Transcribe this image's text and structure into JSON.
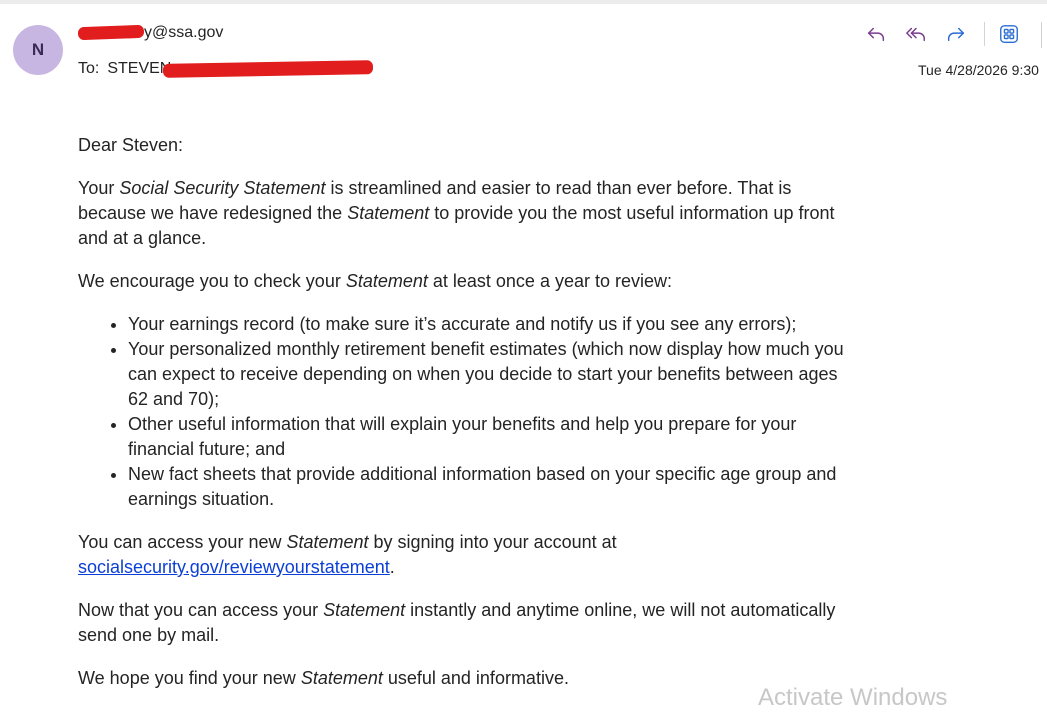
{
  "header": {
    "avatar_initial": "N",
    "sender_email": "y@ssa.gov",
    "to_label": "To:",
    "recipient": "STEVEN",
    "date": "Tue 4/28/2026 9:30"
  },
  "actions": [
    {
      "name": "reply",
      "icon": "reply-icon",
      "color": "#7a3d8f"
    },
    {
      "name": "reply-all",
      "icon": "reply-all-icon",
      "color": "#7a3d8f"
    },
    {
      "name": "forward",
      "icon": "forward-icon",
      "color": "#2b6cd4"
    },
    {
      "name": "apps",
      "icon": "apps-grid-icon",
      "color": "#2b6cd4"
    }
  ],
  "message": {
    "greeting": "Dear Steven:",
    "p1": {
      "a": "Your ",
      "b": "Social Security Statement",
      "c": " is streamlined and easier to read than ever before. That is because we have redesigned the ",
      "d": "Statement",
      "e": " to provide you the most useful information up front and at a glance."
    },
    "p2": {
      "a": "We encourage you to check your ",
      "b": "Statement",
      "c": " at least once a year to review:"
    },
    "bullets": [
      "Your earnings record (to make sure it’s accurate and notify us if you see any errors);",
      "Your personalized monthly retirement benefit estimates (which now display how much you can expect to receive depending on when you decide to start your benefits between ages 62 and 70);",
      "Other useful information that will explain your benefits and help you prepare for your financial future; and",
      "New fact sheets that provide additional information based on your specific age group and earnings situation."
    ],
    "p3": {
      "a": "You can access your new ",
      "b": "Statement",
      "c": " by signing into your account at ",
      "link": "socialsecurity.gov/reviewyourstatement",
      "d": "."
    },
    "p4": {
      "a": "Now that you can access your ",
      "b": "Statement",
      "c": " instantly and anytime online, we will not automatically send one by mail."
    },
    "p5": {
      "a": "We hope you find your new ",
      "b": "Statement",
      "c": " useful and informative."
    }
  },
  "watermark": "Activate Windows"
}
